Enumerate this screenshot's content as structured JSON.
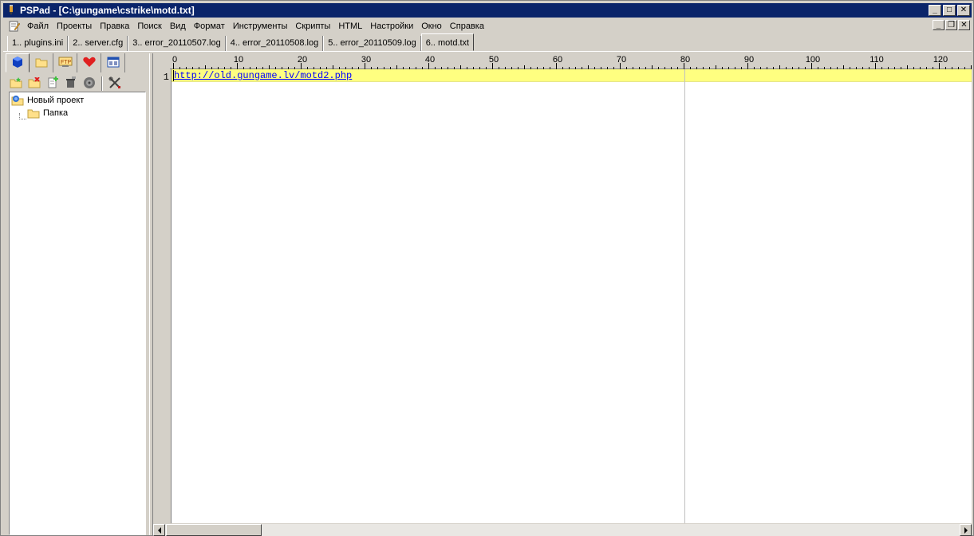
{
  "window": {
    "title": "PSPad - [C:\\gungame\\cstrike\\motd.txt]",
    "controls": {
      "minimize": "_",
      "maximize": "□",
      "close": "✕"
    }
  },
  "menu": {
    "items": [
      "Файл",
      "Проекты",
      "Правка",
      "Поиск",
      "Вид",
      "Формат",
      "Инструменты",
      "Скрипты",
      "HTML",
      "Настройки",
      "Окно",
      "Справка"
    ],
    "mdi_controls": {
      "minimize": "_",
      "restore": "❐",
      "close": "✕"
    }
  },
  "tabs": [
    {
      "label": "1.. plugins.ini",
      "active": false
    },
    {
      "label": "2.. server.cfg",
      "active": false
    },
    {
      "label": "3.. error_20110507.log",
      "active": false
    },
    {
      "label": "4.. error_20110508.log",
      "active": false
    },
    {
      "label": "5.. error_20110509.log",
      "active": false
    },
    {
      "label": "6.. motd.txt",
      "active": true
    }
  ],
  "left_panel": {
    "tabs": [
      "project-icon",
      "folder-icon",
      "ftp-icon",
      "favorites-heart-icon",
      "windows-list-icon"
    ],
    "toolbar": [
      "new-project-icon",
      "delete-icon",
      "add-file-icon",
      "remove-icon",
      "disk-icon",
      "tools-icon"
    ],
    "tree": {
      "project_label": "Новый проект",
      "folder_label": "Папка"
    }
  },
  "ruler": {
    "labels": [
      "0",
      "10",
      "20",
      "30",
      "40",
      "50",
      "60",
      "70",
      "80",
      "90",
      "100",
      "110",
      "120"
    ]
  },
  "editor": {
    "line_number": "1",
    "line_text": "http://old.gungame.lv/motd2.php",
    "current_line_color": "#ffff80",
    "link_color": "#0000ff"
  },
  "colors": {
    "titlebar": "#0a246a",
    "chrome": "#d4d0c8"
  }
}
